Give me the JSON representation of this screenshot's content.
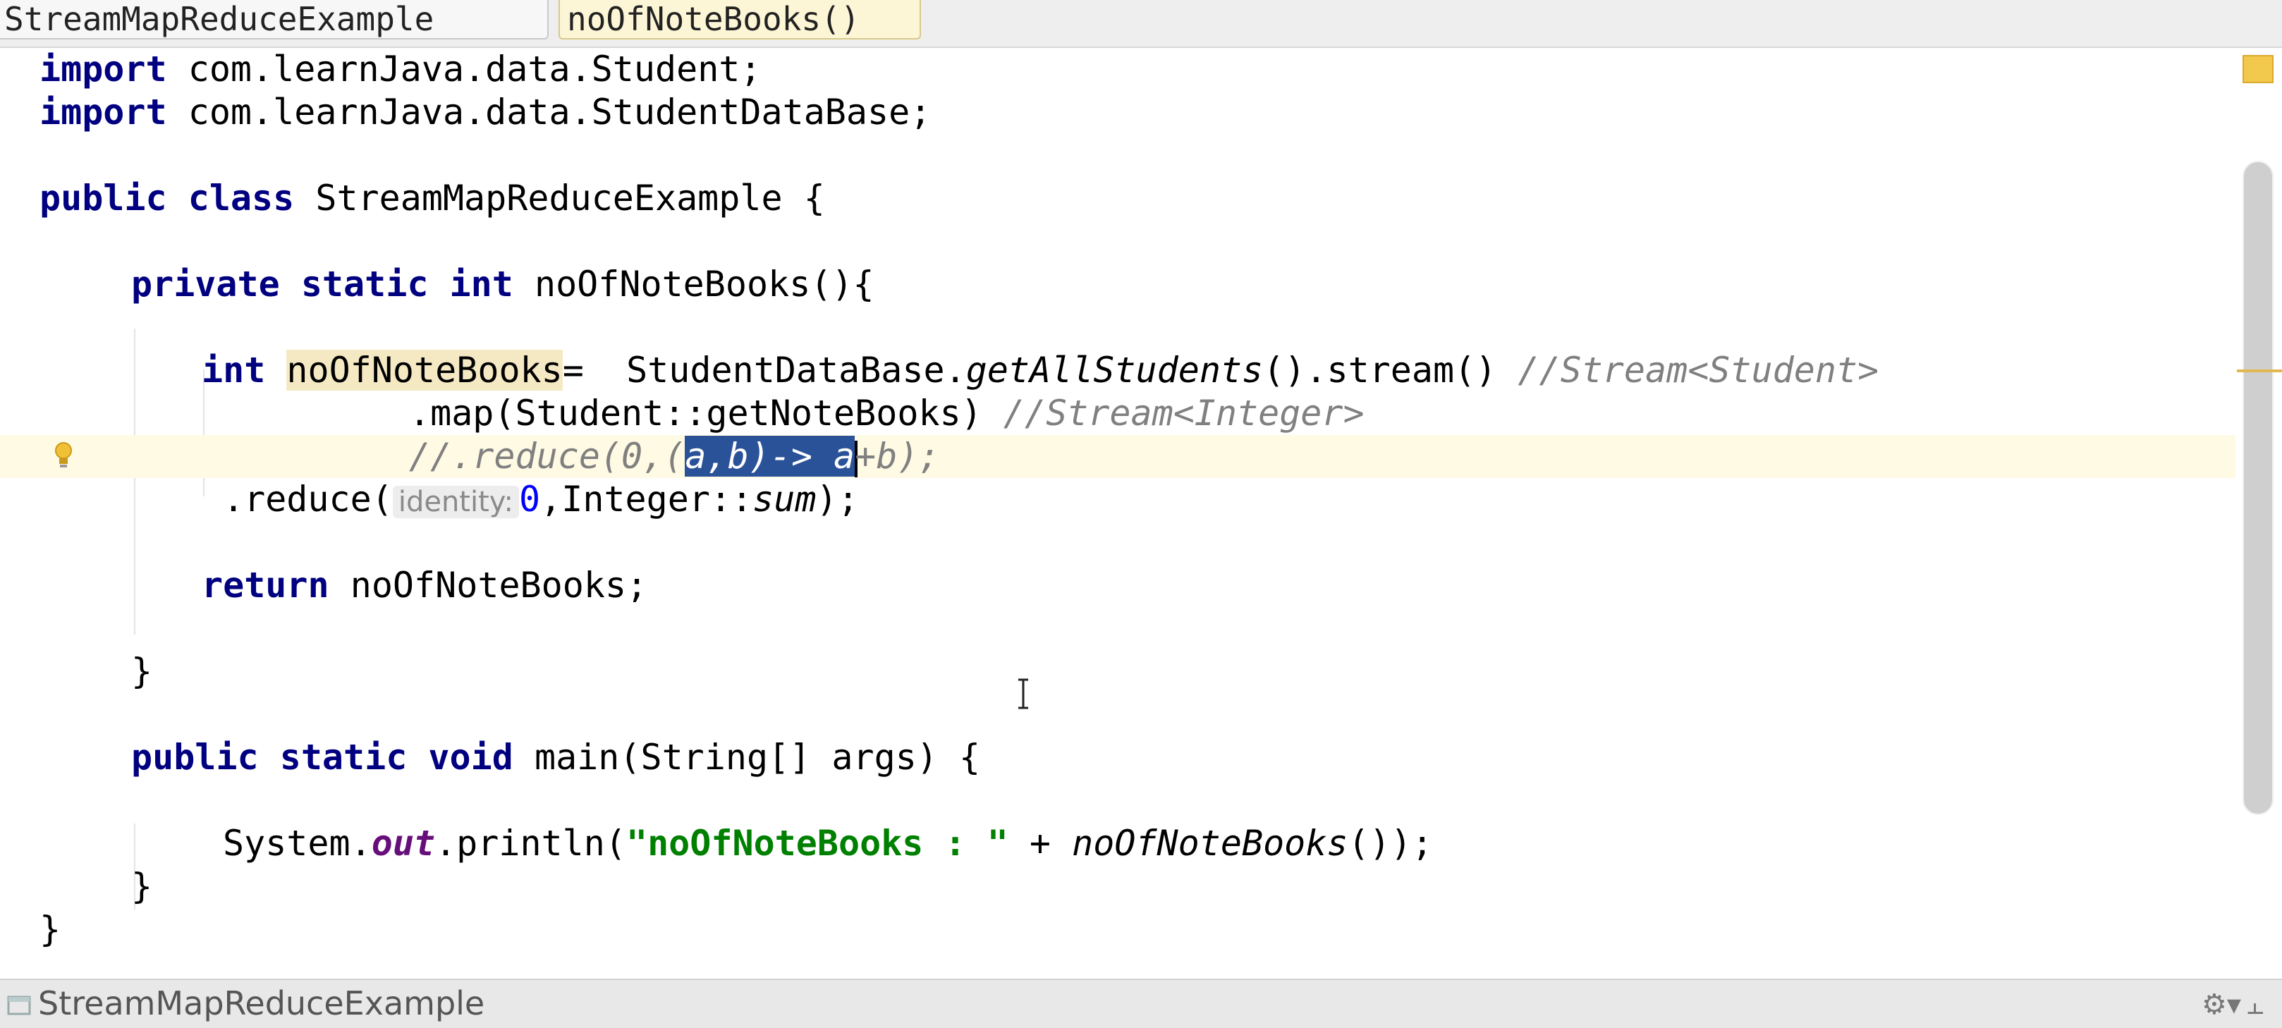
{
  "breadcrumbs": [
    "StreamMapReduceExample",
    "noOfNoteBooks()"
  ],
  "code": {
    "l1_kw": "import",
    "l1_rest": " com.learnJava.data.Student;",
    "l2_kw": "import",
    "l2_rest": " com.learnJava.data.StudentDataBase;",
    "l4_kw": "public class",
    "l4_rest": " StreamMapReduceExample {",
    "l6_kw": "private static int",
    "l6_rest": " noOfNoteBooks(){",
    "l8_kw": "int",
    "l8_var": "noOfNoteBooks",
    "l8_mid": "=  StudentDataBase.",
    "l8_call": "getAllStudents",
    "l8_end": "().stream() ",
    "l8_cmt": "//Stream<Student>",
    "l9_code": ".map(Student::getNoteBooks) ",
    "l9_cmt": "//Stream<Integer>",
    "l10_pre": "//.reduce(0,(",
    "l10_sel": "a,b)-> a",
    "l10_post": "+b);",
    "l11_pre": ".reduce(",
    "l11_hint": "identity:",
    "l11_num": "0",
    "l11_mid": ",Integer::",
    "l11_call": "sum",
    "l11_end": ");",
    "l13_kw": "return",
    "l13_rest": " noOfNoteBooks;",
    "l15_brace": "}",
    "l17_kw": "public static void",
    "l17_rest": " main(String[] args) {",
    "l19_pre": "System.",
    "l19_field": "out",
    "l19_mid": ".println(",
    "l19_str": "\"noOfNoteBooks : \"",
    "l19_plus": " + ",
    "l19_call": "noOfNoteBooks",
    "l19_end": "());",
    "l20_brace": "}",
    "l21_brace": "}"
  },
  "status_bar": {
    "title": "StreamMapReduceExample",
    "gear_glyph": "⚙▾",
    "pin_glyph": "⫠"
  },
  "colors": {
    "keyword": "#000080",
    "comment": "#808080",
    "string": "#008000",
    "selection": "#2a5299",
    "current_line": "#fffae3"
  }
}
